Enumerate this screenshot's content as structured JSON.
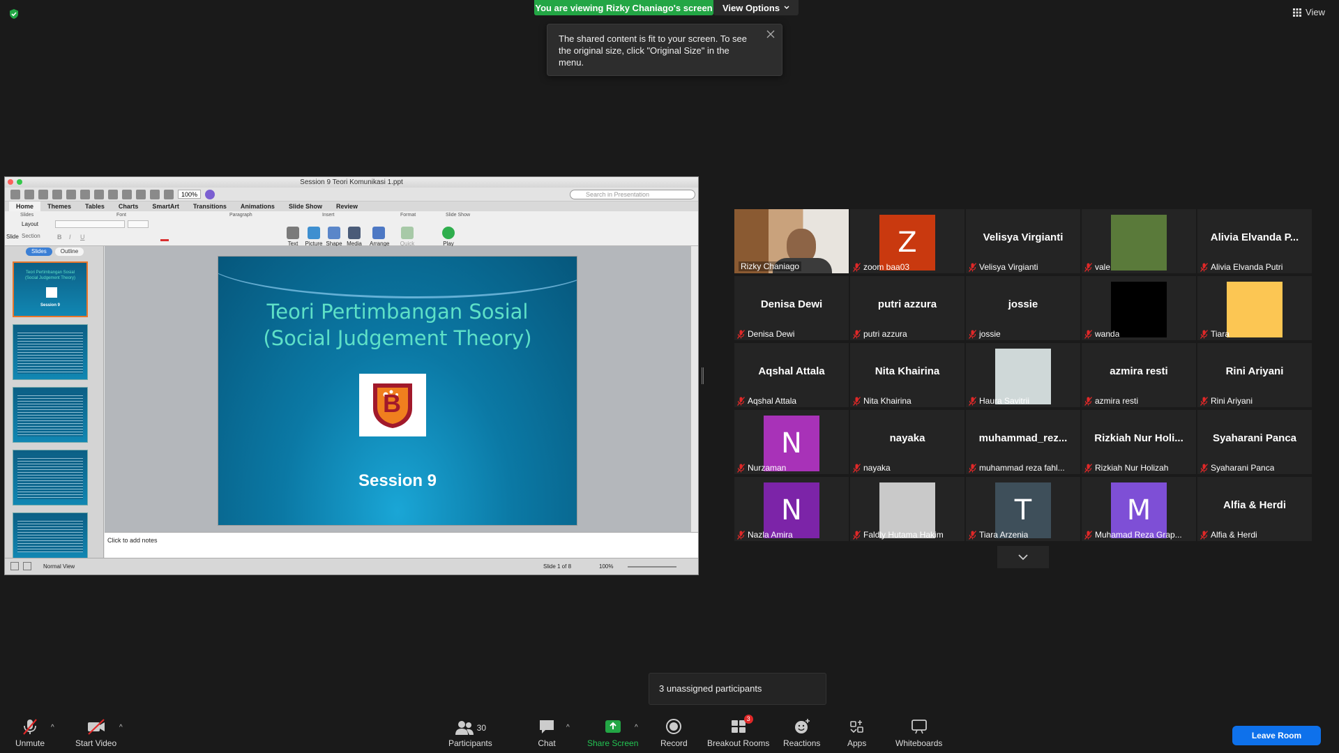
{
  "banner": {
    "viewing_text": "You are viewing Rizky Chaniago's screen",
    "view_options_label": "View Options"
  },
  "top_right": {
    "view_label": "View"
  },
  "tooltip": {
    "text": "The shared content is fit to your screen. To see the original size, click \"Original Size\" in the menu."
  },
  "ppt": {
    "window_title": "Session 9 Teori Komunikasi 1.ppt",
    "zoom": "100%",
    "search_placeholder": "Search in Presentation",
    "tabs": [
      "Home",
      "Themes",
      "Tables",
      "Charts",
      "SmartArt",
      "Transitions",
      "Animations",
      "Slide Show",
      "Review"
    ],
    "groups": {
      "slides": "Slides",
      "font": "Font",
      "paragraph": "Paragraph",
      "insert": "Insert",
      "format": "Format",
      "slideshow": "Slide Show"
    },
    "layout_label": "Layout",
    "section_label": "Section",
    "new_slide_label": "Slide",
    "insert_buttons": [
      "Text",
      "Picture",
      "Shape",
      "Media"
    ],
    "format_buttons": [
      "Arrange",
      "Quick Styles"
    ],
    "play_label": "Play",
    "side_tabs": {
      "slides": "Slides",
      "outline": "Outline"
    },
    "slide": {
      "title_line1": "Teori Pertimbangan Sosial",
      "title_line2": "(Social Judgement Theory)",
      "subtitle": "Session 9",
      "logo_letter": "B"
    },
    "notes_placeholder": "Click to add notes",
    "status": {
      "view": "Normal View",
      "slide_counter": "Slide 1 of 8",
      "zoom": "100%"
    }
  },
  "participants": [
    {
      "display": "video",
      "label": "Rizky Chaniago",
      "muted": false,
      "active": true
    },
    {
      "display": "avatar",
      "initial": "Z",
      "avatar_color": "#c9390f",
      "label": "zoom baa03",
      "muted": true
    },
    {
      "display": "name",
      "big_name": "Velisya Virgianti",
      "label": "Velisya Virgianti",
      "muted": true
    },
    {
      "display": "photo",
      "label": "vale",
      "muted": true,
      "photo_color": "#5a7a3a"
    },
    {
      "display": "name",
      "big_name": "Alivia Elvanda P...",
      "label": "Alivia Elvanda Putri",
      "muted": true
    },
    {
      "display": "name",
      "big_name": "Denisa Dewi",
      "label": "Denisa Dewi",
      "muted": true
    },
    {
      "display": "name",
      "big_name": "putri azzura",
      "label": "putri azzura",
      "muted": true
    },
    {
      "display": "name",
      "big_name": "jossie",
      "label": "jossie",
      "muted": true
    },
    {
      "display": "photo",
      "label": "wanda",
      "muted": true,
      "photo_color": "#000000"
    },
    {
      "display": "photo",
      "label": "Tiara",
      "muted": true,
      "photo_color": "#fcc653"
    },
    {
      "display": "name",
      "big_name": "Aqshal Attala",
      "label": "Aqshal Attala",
      "muted": true
    },
    {
      "display": "name",
      "big_name": "Nita Khairina",
      "label": "Nita Khairina",
      "muted": true
    },
    {
      "display": "photo",
      "label": "Haura Savitrii",
      "muted": true,
      "photo_color": "#cfd8d8"
    },
    {
      "display": "name",
      "big_name": "azmira resti",
      "label": "azmira resti",
      "muted": true
    },
    {
      "display": "name",
      "big_name": "Rini Ariyani",
      "label": "Rini Ariyani",
      "muted": true
    },
    {
      "display": "avatar",
      "initial": "N",
      "avatar_color": "#a832b8",
      "label": "Nurzaman",
      "muted": true
    },
    {
      "display": "name",
      "big_name": "nayaka",
      "label": "nayaka",
      "muted": true
    },
    {
      "display": "name",
      "big_name": "muhammad_rez...",
      "label": "muhammad reza fahl...",
      "muted": true
    },
    {
      "display": "name",
      "big_name": "Rizkiah Nur Holi...",
      "label": "Rizkiah Nur Holizah",
      "muted": true
    },
    {
      "display": "name",
      "big_name": "Syaharani Panca",
      "label": "Syaharani Panca",
      "muted": true
    },
    {
      "display": "avatar",
      "initial": "N",
      "avatar_color": "#7c24a8",
      "label": "Nazla Amira",
      "muted": true
    },
    {
      "display": "photo",
      "label": "Faldly Hutama Hakim",
      "muted": true,
      "photo_color": "#c9c9c9"
    },
    {
      "display": "avatar",
      "initial": "T",
      "avatar_color": "#3e4f5a",
      "label": "Tiara Arzenia",
      "muted": true
    },
    {
      "display": "avatar",
      "initial": "M",
      "avatar_color": "#7e4fd6",
      "label": "Muhamad Reza Grap...",
      "muted": true
    },
    {
      "display": "name",
      "big_name": "Alfia & Herdi",
      "label": "Alfia & Herdi",
      "muted": true
    }
  ],
  "breakout_popup": {
    "text": "3 unassigned participants"
  },
  "toolbar": {
    "unmute": "Unmute",
    "start_video": "Start Video",
    "participants": "Participants",
    "participants_count": "30",
    "chat": "Chat",
    "share_screen": "Share Screen",
    "record": "Record",
    "breakout_rooms": "Breakout Rooms",
    "breakout_badge": "3",
    "reactions": "Reactions",
    "apps": "Apps",
    "whiteboards": "Whiteboards",
    "leave": "Leave Room"
  },
  "colors": {
    "share_green": "#23a645",
    "leave_blue": "#0e71eb",
    "active_speaker": "#d8e84a",
    "muted_red": "#e02828"
  }
}
